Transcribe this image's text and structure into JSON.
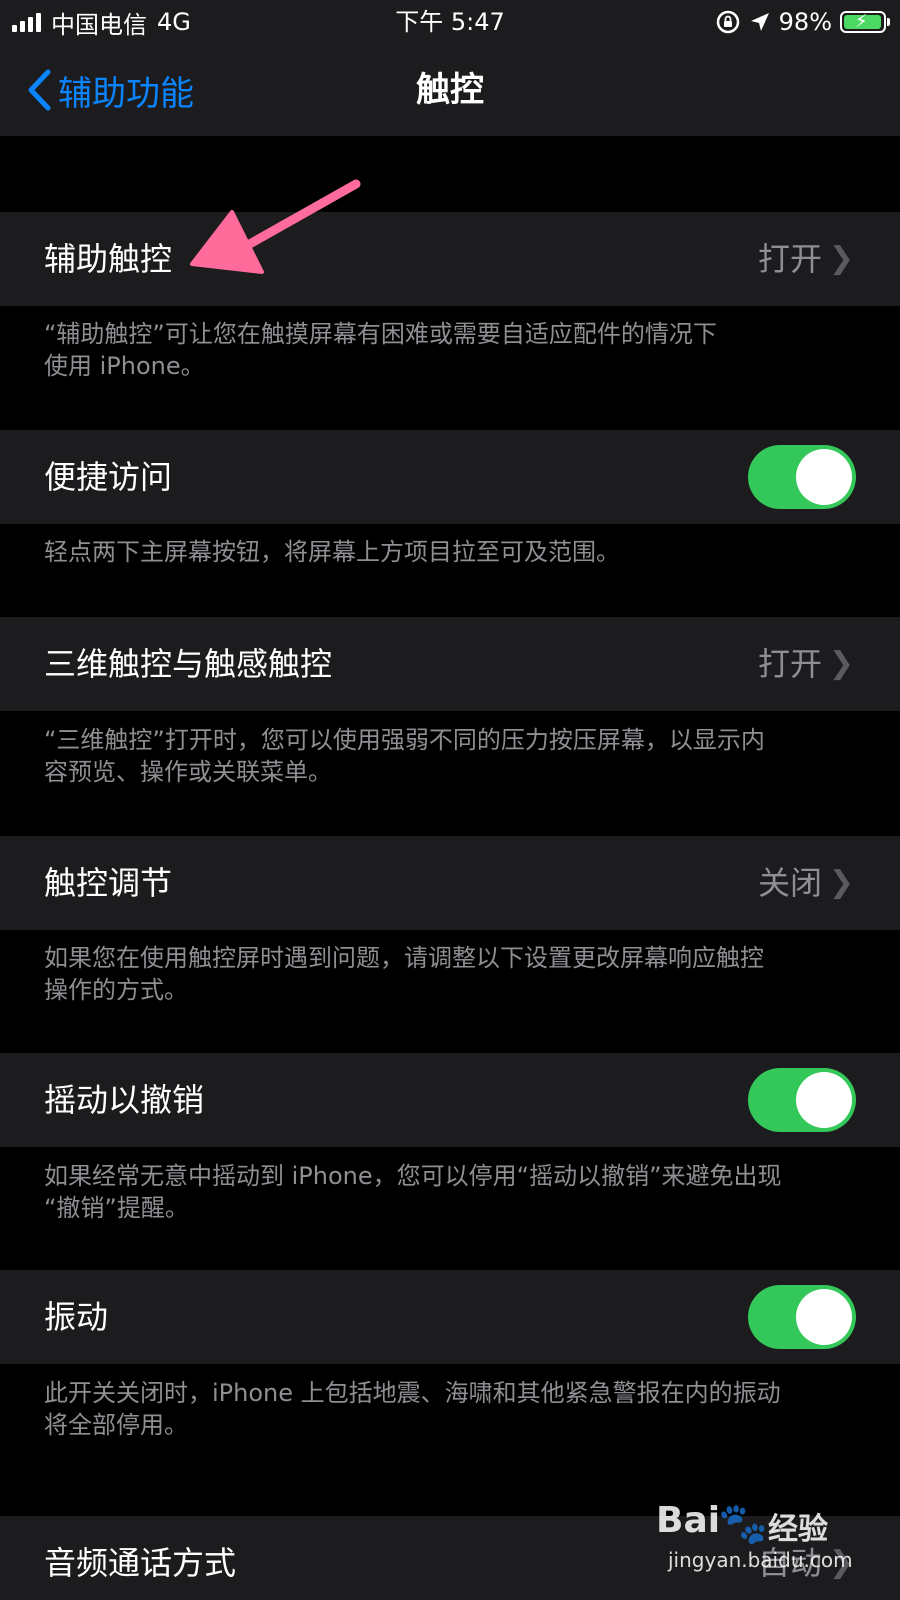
{
  "status_bar": {
    "carrier": "中国电信",
    "network": "4G",
    "time": "下午 5:47",
    "battery": "98%",
    "battery_level": 0.98,
    "icons": [
      "signal-icon",
      "orientation-lock-icon",
      "location-icon",
      "battery-icon"
    ]
  },
  "nav": {
    "back_label": "辅助功能",
    "title": "触控"
  },
  "rows": [
    {
      "label": "辅助触控",
      "value": "打开",
      "control": "disclosure",
      "footer_lines": [
        "“辅助触控”可让您在触摸屏幕有困难或需要自适应配件的情况下",
        "使用 iPhone。"
      ]
    },
    {
      "label": "便捷访问",
      "control": "toggle",
      "on": true,
      "footer_lines": [
        "轻点两下主屏幕按钮，将屏幕上方项目拉至可及范围。"
      ]
    },
    {
      "label": "三维触控与触感触控",
      "value": "打开",
      "control": "disclosure",
      "footer_lines": [
        "“三维触控”打开时，您可以使用强弱不同的压力按压屏幕，以显示内",
        "容预览、操作或关联菜单。"
      ]
    },
    {
      "label": "触控调节",
      "value": "关闭",
      "control": "disclosure",
      "footer_lines": [
        "如果您在使用触控屏时遇到问题，请调整以下设置更改屏幕响应触控",
        "操作的方式。"
      ]
    },
    {
      "label": "摇动以撤销",
      "control": "toggle",
      "on": true,
      "footer_lines": [
        "如果经常无意中摇动到 iPhone，您可以停用“摇动以撤销”来避免出现",
        "“撤销”提醒。"
      ]
    },
    {
      "label": "振动",
      "control": "toggle",
      "on": true,
      "footer_lines": [
        "此开关关闭时，iPhone 上包括地震、海啸和其他紧急警报在内的振动",
        "将全部停用。"
      ]
    },
    {
      "label": "音频通话方式",
      "value": "自动",
      "control": "disclosure"
    }
  ],
  "watermark": {
    "brand": "Bai",
    "brand_suffix": "经验",
    "url": "jingyan.baidu.com"
  },
  "colors": {
    "accent": "#0a84ff",
    "toggle_on": "#34c759",
    "arrow": "#ff6b9a"
  }
}
